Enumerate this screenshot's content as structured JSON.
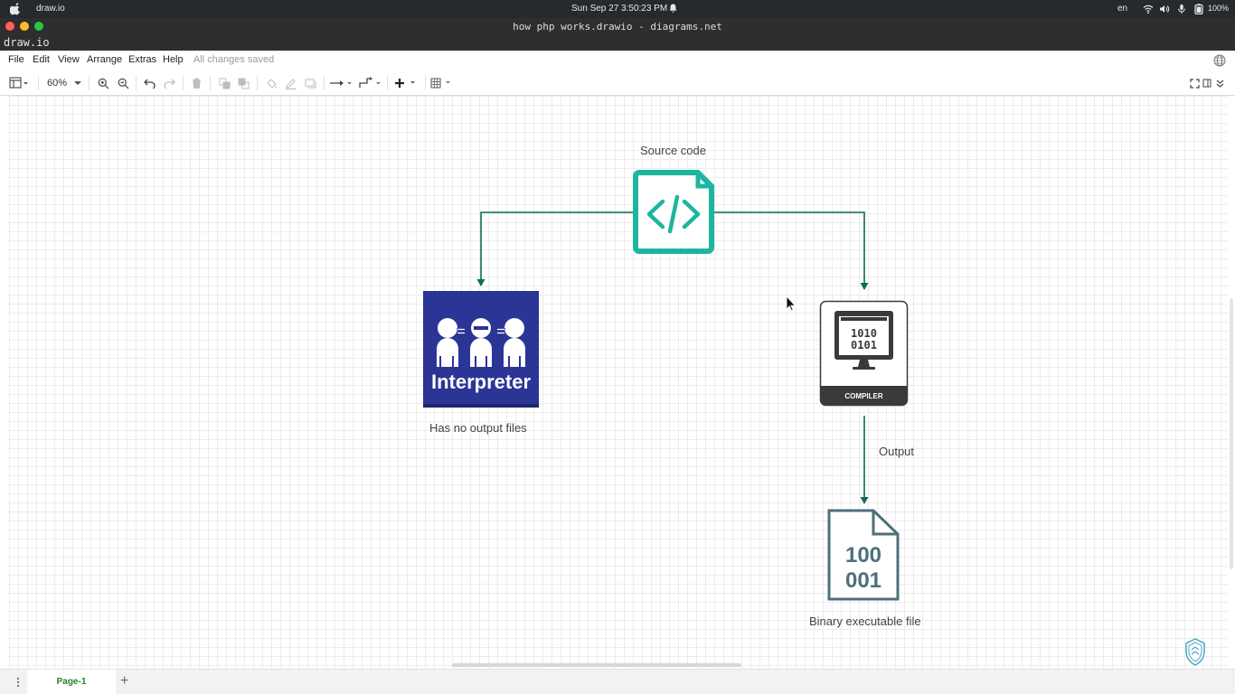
{
  "os_bar": {
    "app_name": "draw.io",
    "clock": "Sun Sep 27   3:50:23 PM",
    "lang": "en",
    "battery": "100%"
  },
  "window": {
    "title": "how php works.drawio - diagrams.net",
    "brand": "draw.io"
  },
  "menu": {
    "items": [
      "File",
      "Edit",
      "View",
      "Arrange",
      "Extras",
      "Help"
    ],
    "save_status": "All changes saved"
  },
  "toolbar": {
    "zoom": "60%"
  },
  "diagram": {
    "source_label": "Source code",
    "interpreter_text": "Interpreter",
    "interpreter_caption": "Has no output files",
    "compiler_text": "COMPILER",
    "output_label": "Output",
    "binary_line1": "100",
    "binary_line2": "001",
    "binary_caption": "Binary executable file"
  },
  "pages": {
    "active": "Page-1"
  },
  "colors": {
    "teal": "#1cb6a0",
    "edge": "#0e6b5a",
    "interpreter_blue": "#2b3596",
    "compiler_dark": "#3a3a3a",
    "binary_slate": "#4d6f7a",
    "page_tab_green": "#2a7d2a"
  },
  "icons": {
    "source": "code-file-icon",
    "interpreter": "interpreter-icon",
    "compiler": "compiler-icon",
    "binary": "binary-file-icon"
  }
}
